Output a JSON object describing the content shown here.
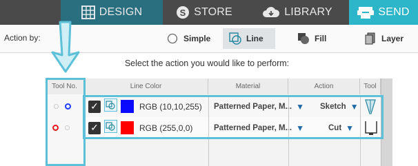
{
  "nav": {
    "tabs": [
      {
        "label": "DESIGN",
        "icon": "grid-icon"
      },
      {
        "label": "STORE",
        "icon": "store-s-icon"
      },
      {
        "label": "LIBRARY",
        "icon": "cloud-library-icon"
      },
      {
        "label": "SEND",
        "icon": "send-printer-icon"
      }
    ]
  },
  "action_bar": {
    "label": "Action by:",
    "options": [
      {
        "label": "Simple",
        "icon": "radio-icon"
      },
      {
        "label": "Line",
        "icon": "line-icon"
      },
      {
        "label": "Fill",
        "icon": "fill-icon"
      },
      {
        "label": "Layer",
        "icon": "layer-icon"
      }
    ]
  },
  "prompt": "Select the action you would like to perform:",
  "table": {
    "headers": {
      "tool_no": "Tool No.",
      "line_color": "Line Color",
      "material": "Material",
      "action": "Action",
      "tool": "Tool"
    },
    "rows": [
      {
        "rgb": "RGB (10,10,255)",
        "material": "Patterned Paper, M...",
        "action": "Sketch",
        "tool": "pen-tool-icon"
      },
      {
        "rgb": "RGB (255,0,0)",
        "material": "Patterned Paper, M...",
        "action": "Cut",
        "tool": "blade-tool-icon"
      }
    ]
  },
  "colors": {
    "accent": "#2db5c9",
    "highlight": "#5bc0d8",
    "row1_swatch": "#0a0aff",
    "row2_swatch": "#ff0000",
    "topbar": "#4a4a4a"
  }
}
